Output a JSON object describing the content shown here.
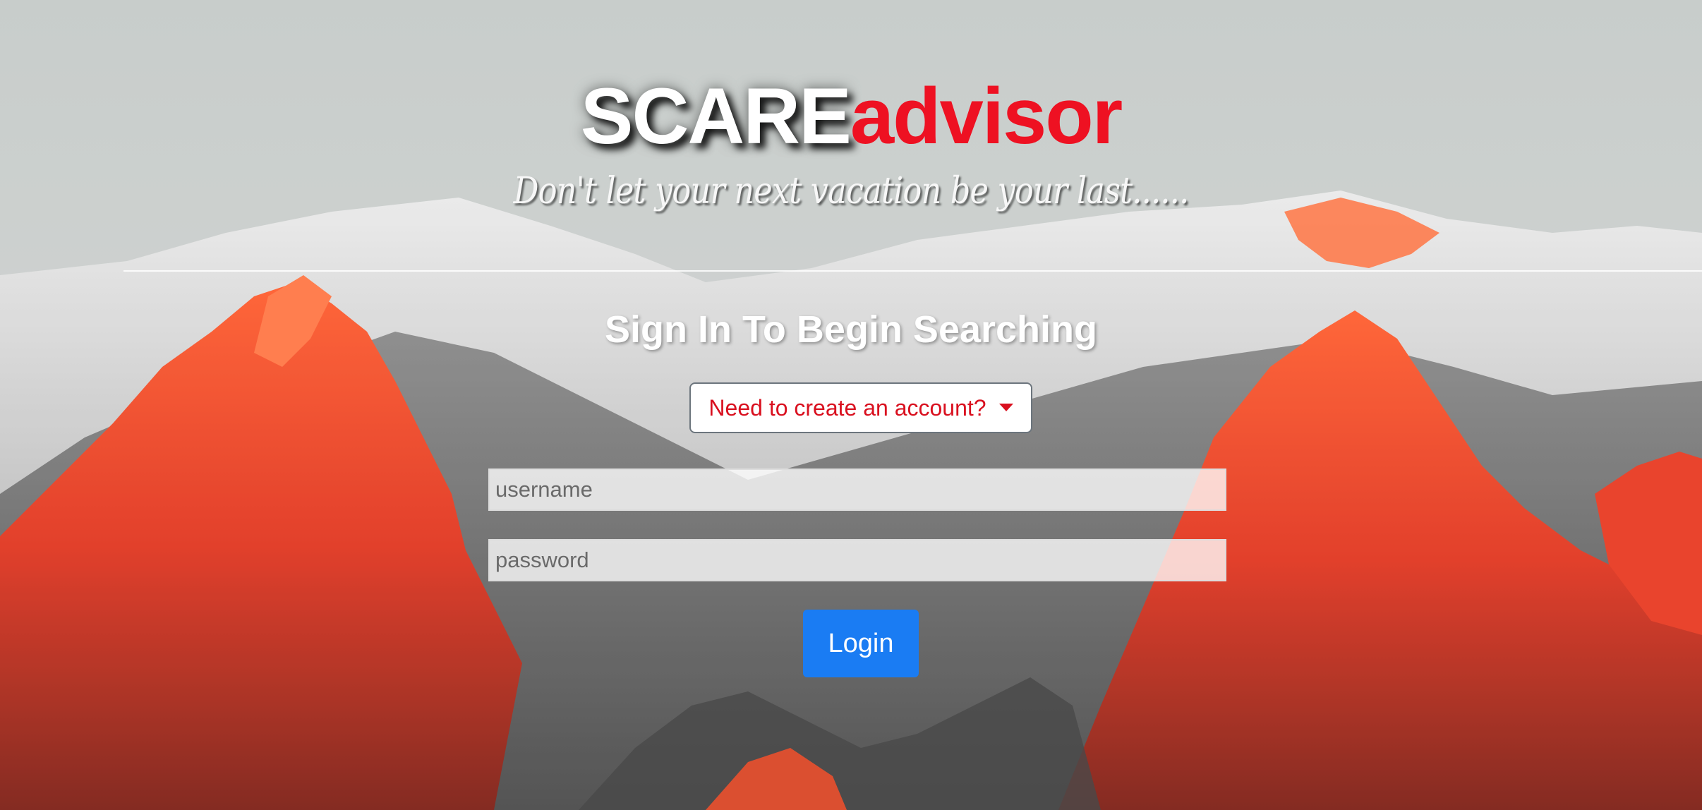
{
  "header": {
    "brand_part1": "SCARE",
    "brand_part2": "advisor",
    "tagline": "Don't let your next vacation be your last......"
  },
  "signin": {
    "title": "Sign In To Begin Searching",
    "create_account_label": "Need to create an account?",
    "username_placeholder": "username",
    "password_placeholder": "password",
    "login_label": "Login"
  },
  "colors": {
    "brand_red": "#ee1122",
    "login_blue": "#1a7cf3",
    "dropdown_text": "#d9101f"
  },
  "icons": {
    "dropdown": "caret-down-icon"
  }
}
